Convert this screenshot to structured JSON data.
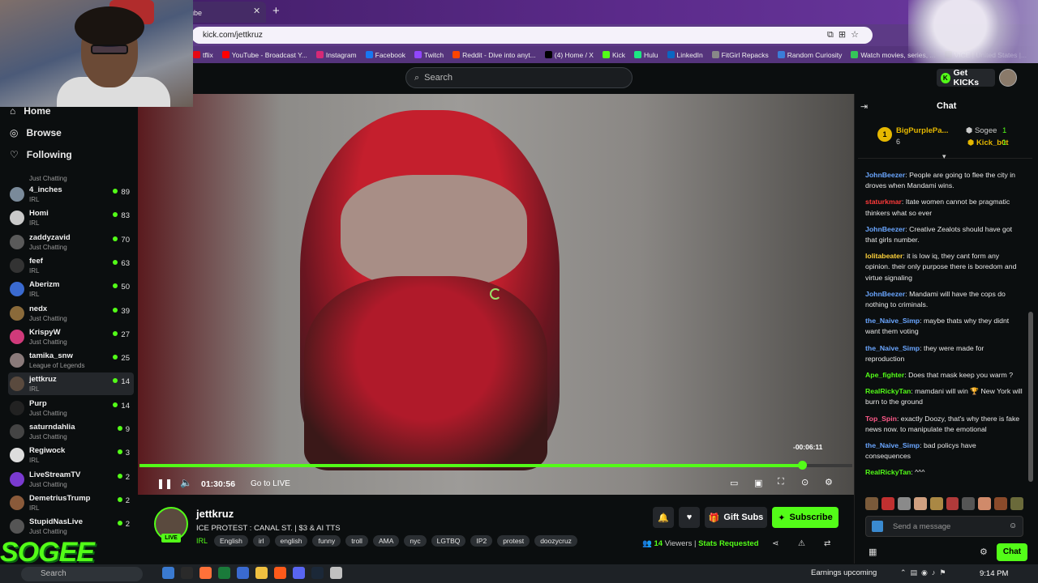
{
  "browser": {
    "tab_title": "ube",
    "url": "kick.com/jettkruz",
    "bookmarks": [
      {
        "label": "tflix",
        "color": "#e50914"
      },
      {
        "label": "YouTube - Broadcast Y...",
        "color": "#ff0000"
      },
      {
        "label": "Instagram",
        "color": "#d62976"
      },
      {
        "label": "Facebook",
        "color": "#1877f2"
      },
      {
        "label": "Twitch",
        "color": "#9146ff"
      },
      {
        "label": "Reddit - Dive into anyt...",
        "color": "#ff4500"
      },
      {
        "label": "(4) Home / X",
        "color": "#000000"
      },
      {
        "label": "Kick",
        "color": "#53fc18"
      },
      {
        "label": "Hulu",
        "color": "#1ce783"
      },
      {
        "label": "LinkedIn",
        "color": "#0a66c2"
      },
      {
        "label": "FitGirl Repacks",
        "color": "#888888"
      },
      {
        "label": "Random Curiosity",
        "color": "#3b7dd8"
      },
      {
        "label": "Watch movies, series, ...",
        "color": "#35c759"
      },
      {
        "label": "VICE | United States |...",
        "color": "#111111"
      }
    ]
  },
  "header": {
    "search_placeholder": "Search",
    "get_kicks_label": "Get KICKs"
  },
  "sidebar": {
    "nav": [
      {
        "label": "Home",
        "icon": "home-icon"
      },
      {
        "label": "Browse",
        "icon": "compass-icon"
      },
      {
        "label": "Following",
        "icon": "heart-icon"
      }
    ],
    "partial_top_category": "Just Chatting",
    "channels": [
      {
        "name": "4_inches",
        "category": "IRL",
        "viewers": "89",
        "color": "#7a8a9a"
      },
      {
        "name": "Homi",
        "category": "IRL",
        "viewers": "83",
        "color": "#c9c9c9"
      },
      {
        "name": "zaddyzavid",
        "category": "Just Chatting",
        "viewers": "70",
        "color": "#5a5a5a"
      },
      {
        "name": "feef",
        "category": "IRL",
        "viewers": "63",
        "color": "#333333"
      },
      {
        "name": "Aberizm",
        "category": "IRL",
        "viewers": "50",
        "color": "#3a6ad0"
      },
      {
        "name": "nedx",
        "category": "Just Chatting",
        "viewers": "39",
        "color": "#8a6a3a"
      },
      {
        "name": "KrispyW",
        "category": "Just Chatting",
        "viewers": "27",
        "color": "#d03a7a"
      },
      {
        "name": "tamika_snw",
        "category": "League of Legends",
        "viewers": "25",
        "color": "#8a7a7a"
      },
      {
        "name": "jettkruz",
        "category": "IRL",
        "viewers": "14",
        "color": "#5a4a3e",
        "selected": true
      },
      {
        "name": "Purp",
        "category": "Just Chatting",
        "viewers": "14",
        "color": "#222222"
      },
      {
        "name": "saturndahlia",
        "category": "Just Chatting",
        "viewers": "9",
        "color": "#444444"
      },
      {
        "name": "Regiwock",
        "category": "IRL",
        "viewers": "3",
        "color": "#dddddd"
      },
      {
        "name": "LiveStreamTV",
        "category": "Just Chatting",
        "viewers": "2",
        "color": "#7a3ad0"
      },
      {
        "name": "DemetriusTrump",
        "category": "IRL",
        "viewers": "2",
        "color": "#8a5a3a"
      },
      {
        "name": "StupidNasLive",
        "category": "Just Chatting",
        "viewers": "2",
        "color": "#555555"
      }
    ]
  },
  "player": {
    "elapsed": "01:30:56",
    "go_live_label": "Go to LIVE",
    "hover_time": "-00:06:11",
    "progress_fraction": 0.93
  },
  "stream": {
    "streamer": "jettkruz",
    "live_label": "LIVE",
    "title": "ICE PROTEST : CANAL ST. | $3 & AI TTS",
    "category": "IRL",
    "tags": [
      "English",
      "irl",
      "english",
      "funny",
      "troll",
      "AMA",
      "nyc",
      "LGTBQ",
      "IP2",
      "protest",
      "doozycruz"
    ],
    "gift_subs_label": "Gift Subs",
    "subscribe_label": "Subscribe",
    "viewers_count": "14",
    "viewers_label": "Viewers",
    "stats_label": "Stats Requested"
  },
  "chat": {
    "title": "Chat",
    "leaderboard": [
      {
        "name": "BigPurplePa...",
        "value": "6",
        "rank": "1"
      },
      {
        "name": "Sogee",
        "value": "1"
      },
      {
        "name": "Kick_b0t",
        "value": "1"
      }
    ],
    "messages": [
      {
        "user": "JohnBeezer",
        "color": "#6aa6ff",
        "text": "People are going to flee the city in droves when Mandami wins."
      },
      {
        "user": "staturkmar",
        "color": "#ff3a3a",
        "text": "Itate women cannot be pragmatic thinkers what so ever"
      },
      {
        "user": "JohnBeezer",
        "color": "#6aa6ff",
        "text": "Creative Zealots should have got that girls number."
      },
      {
        "user": "lolitabeater",
        "color": "#ffd23a",
        "text": "it is low iq, they cant form any opinion. their only purpose there is boredom and virtue signaling"
      },
      {
        "user": "JohnBeezer",
        "color": "#6aa6ff",
        "text": "Mandami will have the cops do nothing to criminals."
      },
      {
        "user": "the_Naive_Simp",
        "color": "#6aa6ff",
        "text": "maybe thats why they didnt want them voting"
      },
      {
        "user": "the_Naive_Simp",
        "color": "#6aa6ff",
        "text": "they were made for reproduction"
      },
      {
        "user": "Ape_fighter",
        "color": "#53fc18",
        "text": "Does that mask keep you warm ?"
      },
      {
        "user": "RealRickyTan",
        "color": "#53fc18",
        "text": "mamdani will win 🏆 New York will burn to the ground"
      },
      {
        "user": "Top_Spin",
        "color": "#ff5a8a",
        "text": "exactly Doozy, that's why there is fake news now. to manipulate the emotional"
      },
      {
        "user": "the_Naive_Simp",
        "color": "#6aa6ff",
        "text": "bad policys have consequences"
      },
      {
        "user": "RealRickyTan",
        "color": "#53fc18",
        "text": "^^^"
      }
    ],
    "input_placeholder": "Send a message",
    "send_label": "Chat"
  },
  "overlay": {
    "sogee_text": "SOGEE"
  },
  "taskbar": {
    "search_label": "Search",
    "news": "Earnings upcoming",
    "clock": "9:14 PM"
  }
}
